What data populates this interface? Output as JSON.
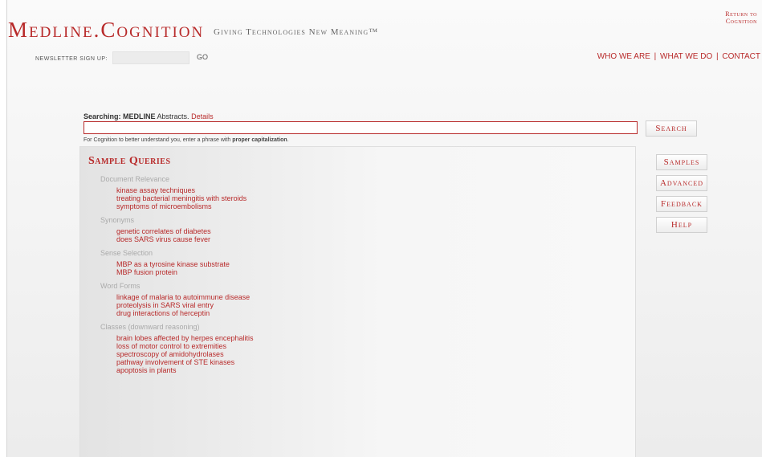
{
  "header": {
    "logo": "Medline.Cognition",
    "tagline": "Giving Technologies New Meaning™",
    "return_link": "Return to Cognition"
  },
  "newsletter": {
    "label": "NEWSLETTER SIGN UP:",
    "go": "GO"
  },
  "nav": {
    "who_we_are": "WHO WE ARE",
    "what_we_do": "WHAT WE DO",
    "contact": "CONTACT",
    "separator": "|"
  },
  "search": {
    "label_prefix": "Searching:",
    "source": "MEDLINE",
    "label_suffix": "Abstracts.",
    "details": "Details",
    "value": "",
    "hint_prefix": "For Cognition to better understand you, enter a phrase with",
    "hint_bold": "proper capitalization",
    "hint_suffix": ".",
    "button": "Search"
  },
  "samples": {
    "title": "Sample Queries",
    "groups": [
      {
        "label": "Document Relevance",
        "items": [
          "kinase assay techniques",
          "treating bacterial meningitis with steroids",
          "symptoms of microembolisms"
        ]
      },
      {
        "label": "Synonyms",
        "items": [
          "genetic correlates of diabetes",
          "does SARS virus cause fever"
        ]
      },
      {
        "label": "Sense Selection",
        "items": [
          "MBP as a tyrosine kinase substrate",
          "MBP fusion protein"
        ]
      },
      {
        "label": "Word Forms",
        "items": [
          "linkage of malaria to autoimmune disease",
          "proteolysis in SARS viral entry",
          "drug interactions of herceptin"
        ]
      },
      {
        "label": "Classes (downward reasoning)",
        "items": [
          "brain lobes affected by herpes encephalitis",
          "loss of motor control to extremities",
          "spectroscopy of amidohydrolases",
          "pathway involvement of STE kinases",
          "apoptosis in plants"
        ]
      }
    ]
  },
  "side_buttons": [
    "Samples",
    "Advanced",
    "Feedback",
    "Help"
  ],
  "colors": {
    "accent": "#b82a2a",
    "muted": "#aaaaaa"
  }
}
